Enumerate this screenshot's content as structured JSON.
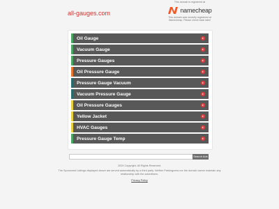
{
  "header": {
    "domain": "all-gauges.com"
  },
  "namecheap": {
    "top_text": "This domain is registered at",
    "logo_text": "namecheap",
    "bottom_text_1": "This domain was recently registered at",
    "bottom_text_2": "Namecheap. Please check back later!",
    "brand_color": "#f05a28"
  },
  "links": [
    {
      "label": "Oil Gauge",
      "accent": "#4aa564"
    },
    {
      "label": "Vacuum Gauge",
      "accent": "#4aa564"
    },
    {
      "label": "Pressure Gauges",
      "accent": "#4aa564"
    },
    {
      "label": "Oil Pressure Gauge",
      "accent": "#e2762f"
    },
    {
      "label": "Pressure Gauge Vacuum",
      "accent": "#2a6c6e"
    },
    {
      "label": "Vacuum Pressure Gauge",
      "accent": "#2a6c6e"
    },
    {
      "label": "Oil Pressure Gauges",
      "accent": "#e8d03c"
    },
    {
      "label": "Yellow Jacket",
      "accent": "#e8d03c"
    },
    {
      "label": "HVAC Gauges",
      "accent": "#e8d03c"
    },
    {
      "label": "Pressure Gauge Temp",
      "accent": "#4aa564"
    }
  ],
  "search": {
    "placeholder": "",
    "button_label": "Search Ads"
  },
  "footer": {
    "copyright": "2024 Copyright. All Rights Reserved.",
    "disclaimer_1": "The Sponsored Listings displayed above are served automatically by a third party. Neither Parkingcrew nor the domain owner maintain any",
    "disclaimer_2": "relationship with the advertisers.",
    "privacy_label": "Privacy Policy"
  }
}
